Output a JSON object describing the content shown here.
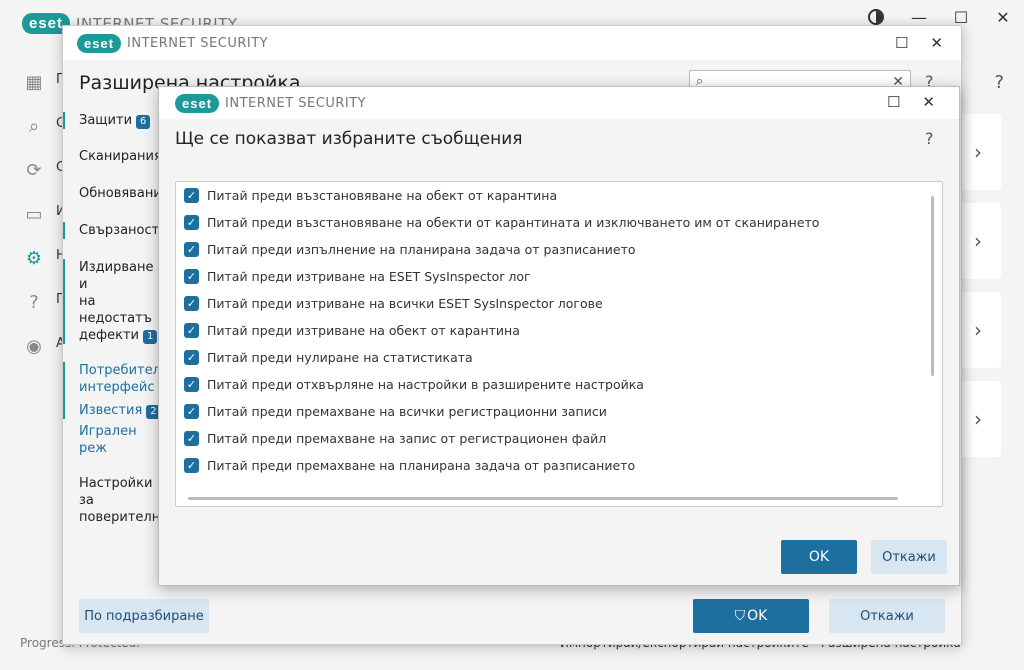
{
  "main": {
    "logo_text": "eset",
    "product": "INTERNET SECURITY",
    "nav_labels": [
      "П",
      "С",
      "С",
      "И",
      "Н",
      "П",
      "А"
    ],
    "help": "?",
    "status": "Progress. Protected.",
    "footer": {
      "import_export": "Импортирай/експортирай настройките",
      "advanced": "Разширена настройка"
    }
  },
  "adv": {
    "logo_text": "eset",
    "product": "INTERNET SECURITY",
    "heading": "Разширена настройка",
    "help": "?",
    "sidebar": {
      "protections": "Защити",
      "protections_count": "6",
      "scans": "Сканирания",
      "updates": "Обновявания",
      "connectivity": "Свързаност",
      "troubleshoot_1": "Издирване и",
      "troubleshoot_2": "на недостатъ",
      "troubleshoot_3": "дефекти",
      "troubleshoot_count": "1",
      "ui_1": "Потребителс",
      "ui_2": "интерфейс",
      "notifications": "Известия",
      "notifications_count": "2",
      "gaming": "Игрален реж",
      "privacy_1": "Настройки за",
      "privacy_2": "поверително"
    },
    "buttons": {
      "default": "По подразбиране",
      "ok": "OK",
      "cancel": "Откажи"
    }
  },
  "dialog": {
    "logo_text": "eset",
    "product": "INTERNET SECURITY",
    "title": "Ще се показват избраните съобщения",
    "help": "?",
    "items": [
      {
        "label": "Питай преди възстановяване на обект от карантина"
      },
      {
        "label": "Питай преди възстановяване на обекти от карантината и изключването им от сканирането"
      },
      {
        "label": "Питай преди изпълнение на планирана задача от разписанието"
      },
      {
        "label": "Питай преди изтриване на ESET SysInspector лог"
      },
      {
        "label": "Питай преди изтриване на всички ESET SysInspector логове"
      },
      {
        "label": "Питай преди изтриване на обект от карантина"
      },
      {
        "label": "Питай преди нулиране на статистиката"
      },
      {
        "label": "Питай преди отхвърляне на настройки в разширените настройка"
      },
      {
        "label": "Питай преди премахване на всички регистрационни записи"
      },
      {
        "label": "Питай преди премахване на запис от регистрационен файл"
      },
      {
        "label": "Питай преди премахване на планирана задача от разписанието"
      }
    ],
    "buttons": {
      "ok": "OK",
      "cancel": "Откажи"
    }
  }
}
